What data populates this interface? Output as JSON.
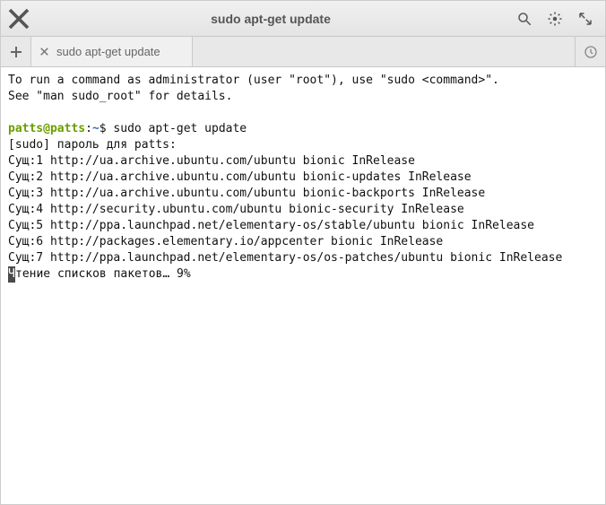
{
  "window": {
    "title": "sudo apt-get update"
  },
  "tabs": {
    "active_label": "sudo apt-get update"
  },
  "terminal": {
    "intro_line1": "To run a command as administrator (user \"root\"), use \"sudo <command>\".",
    "intro_line2": "See \"man sudo_root\" for details.",
    "prompt": {
      "user": "patts",
      "at": "@",
      "host": "patts",
      "colon": ":",
      "path": "~",
      "symbol": "$"
    },
    "command": "sudo apt-get update",
    "sudo_prompt": "[sudo] пароль для patts:",
    "lines": [
      "Сущ:1 http://ua.archive.ubuntu.com/ubuntu bionic InRelease",
      "Сущ:2 http://ua.archive.ubuntu.com/ubuntu bionic-updates InRelease",
      "Сущ:3 http://ua.archive.ubuntu.com/ubuntu bionic-backports InRelease",
      "Сущ:4 http://security.ubuntu.com/ubuntu bionic-security InRelease",
      "Сущ:5 http://ppa.launchpad.net/elementary-os/stable/ubuntu bionic InRelease",
      "Сущ:6 http://packages.elementary.io/appcenter bionic InRelease",
      "Сущ:7 http://ppa.launchpad.net/elementary-os/os-patches/ubuntu bionic InRelease"
    ],
    "progress_first_char": "Ч",
    "progress_rest": "тение списков пакетов… 9%"
  }
}
